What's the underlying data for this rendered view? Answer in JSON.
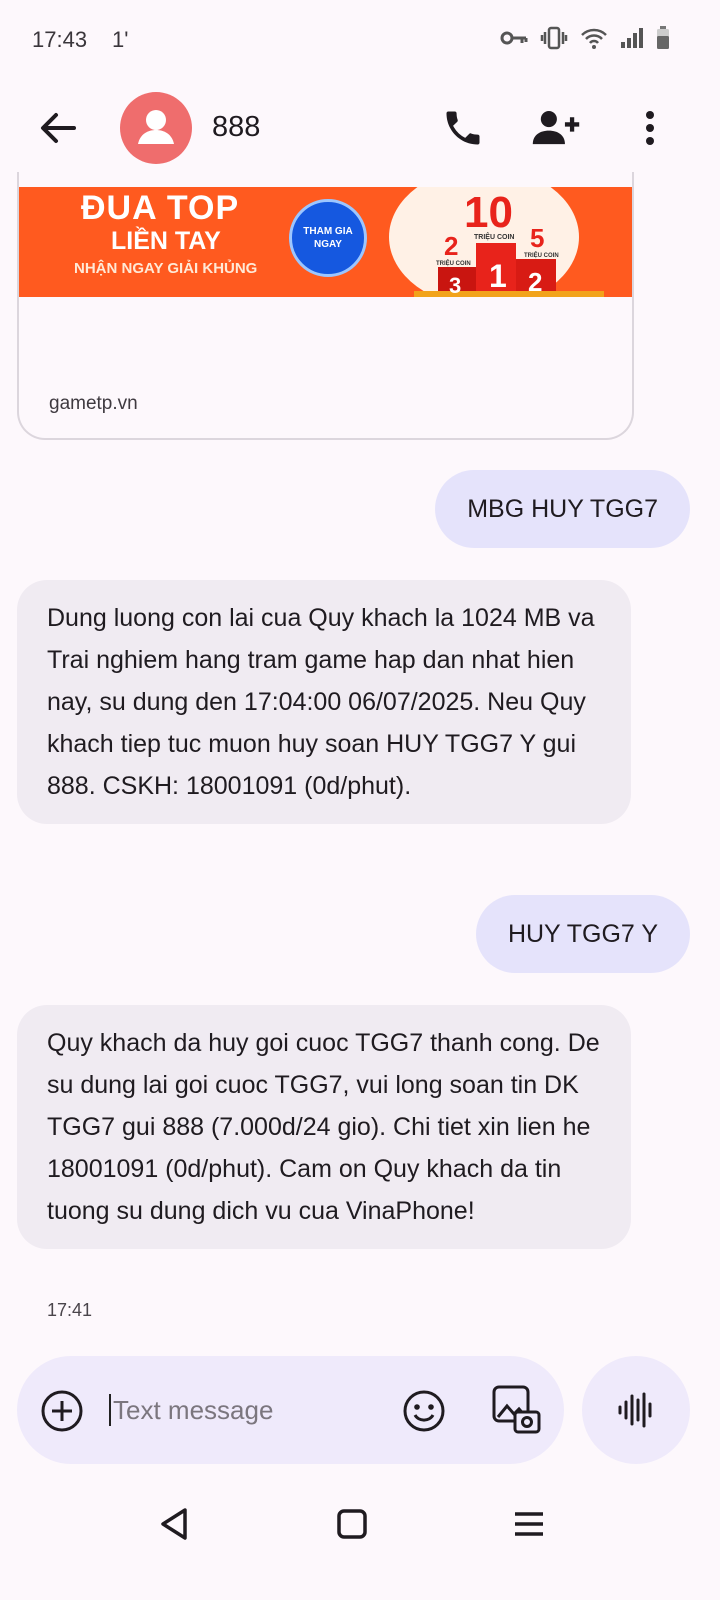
{
  "status_bar": {
    "time": "17:43",
    "network": "1'"
  },
  "header": {
    "title": "888"
  },
  "link_preview": {
    "banner": {
      "line1": "ĐUA TOP",
      "line2": "LIỀN TAY",
      "line3": "NHẬN NGAY GIẢI KHỦNG",
      "button": "THAM GIA NGAY",
      "prizes": [
        {
          "rank": "1",
          "amount": "10",
          "unit": "TRIỆU COIN"
        },
        {
          "rank": "2",
          "amount": "5",
          "unit": "TRIỆU COIN"
        },
        {
          "rank": "3",
          "amount": "2",
          "unit": "TRIỆU COIN"
        }
      ]
    },
    "domain": "gametp.vn"
  },
  "messages": [
    {
      "dir": "out",
      "text": "MBG HUY TGG7"
    },
    {
      "dir": "in",
      "text": "Dung luong con lai cua Quy khach la 1024 MB va Trai nghiem hang tram game hap dan nhat hien nay, su dung den 17:04:00 06/07/2025. Neu Quy khach tiep tuc muon huy soan HUY TGG7 Y gui 888. CSKH: 18001091 (0d/phut)."
    },
    {
      "dir": "out",
      "text": "HUY TGG7 Y"
    },
    {
      "dir": "in",
      "text": "Quy khach da huy goi cuoc TGG7 thanh cong. De su dung lai goi cuoc TGG7, vui long soan tin DK TGG7 gui 888 (7.000d/24 gio). Chi tiet xin lien he 18001091 (0d/phut). Cam on Quy khach da tin tuong su dung dich vu cua VinaPhone!"
    }
  ],
  "last_timestamp": "17:41",
  "compose": {
    "placeholder": "Text message"
  },
  "colors": {
    "avatar": "#ef6d6d",
    "outgoing_bubble": "#e5e3fb",
    "incoming_bubble": "#f0ebf2",
    "banner": "#ff5a1f"
  }
}
